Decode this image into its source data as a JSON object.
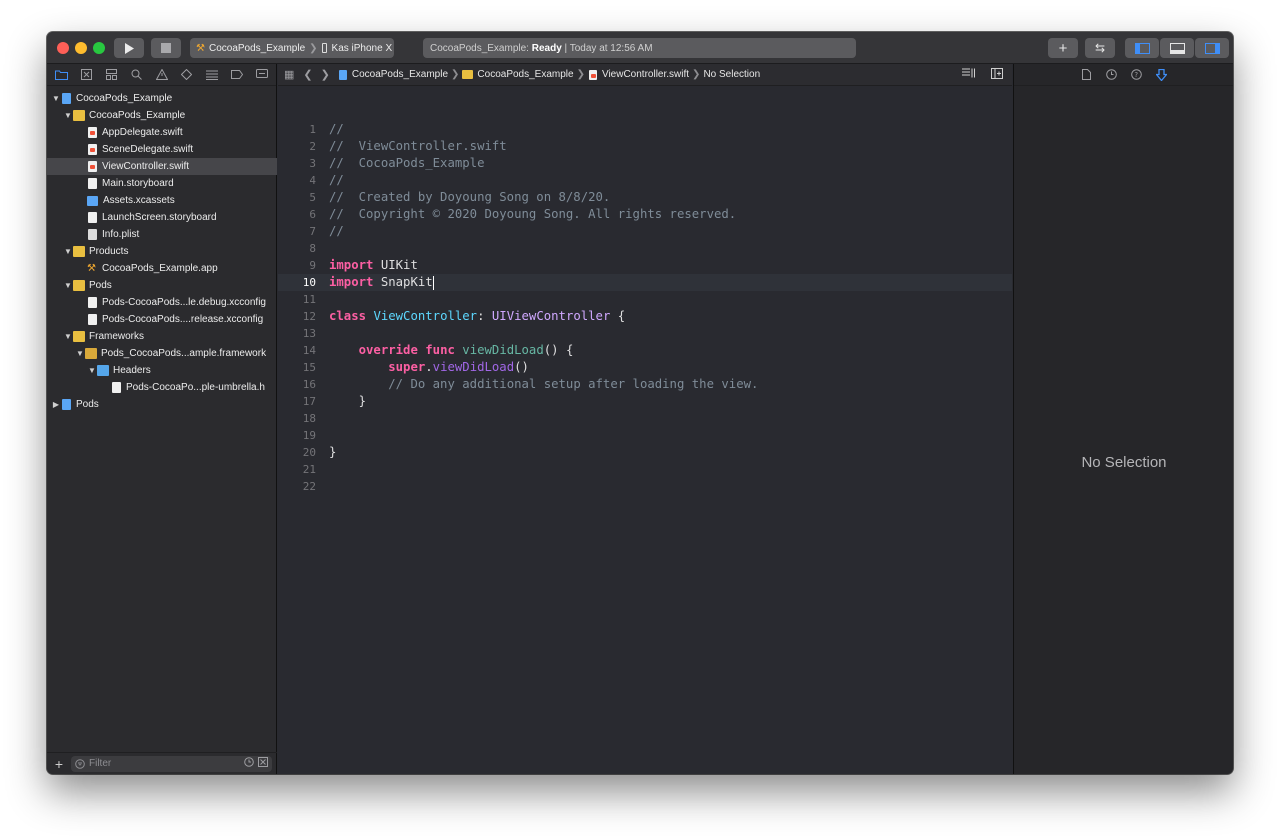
{
  "toolbar": {
    "scheme_name": "CocoaPods_Example",
    "device": "Kas iPhone X",
    "status_project": "CocoaPods_Example:",
    "status_state": "Ready",
    "status_time": "| Today at 12:56 AM",
    "run_icon": "play-icon",
    "stop_icon": "stop-icon",
    "add_icon": "plus-icon",
    "swap_icon": "code-review-icon"
  },
  "navigator": {
    "tabs": [
      "project-navigator",
      "source-control-navigator",
      "symbol-navigator",
      "find-navigator",
      "issue-navigator",
      "test-navigator",
      "debug-navigator",
      "breakpoint-navigator",
      "report-navigator"
    ],
    "items": [
      {
        "label": "CocoaPods_Example",
        "icon": "project-file-icon",
        "level": 0,
        "expanded": true
      },
      {
        "label": "CocoaPods_Example",
        "icon": "folder-icon",
        "level": 1,
        "expanded": true
      },
      {
        "label": "AppDelegate.swift",
        "icon": "swift-file-icon",
        "level": 2
      },
      {
        "label": "SceneDelegate.swift",
        "icon": "swift-file-icon",
        "level": 2
      },
      {
        "label": "ViewController.swift",
        "icon": "swift-file-icon",
        "level": 2,
        "selected": true
      },
      {
        "label": "Main.storyboard",
        "icon": "storyboard-icon",
        "level": 2
      },
      {
        "label": "Assets.xcassets",
        "icon": "assets-icon",
        "level": 2
      },
      {
        "label": "LaunchScreen.storyboard",
        "icon": "storyboard-icon",
        "level": 2
      },
      {
        "label": "Info.plist",
        "icon": "plist-icon",
        "level": 2
      },
      {
        "label": "Products",
        "icon": "folder-icon",
        "level": 1,
        "expanded": true
      },
      {
        "label": "CocoaPods_Example.app",
        "icon": "app-icon",
        "level": 2
      },
      {
        "label": "Pods",
        "icon": "folder-icon",
        "level": 1,
        "expanded": true
      },
      {
        "label": "Pods-CocoaPods...le.debug.xcconfig",
        "icon": "xcconfig-icon",
        "level": 2
      },
      {
        "label": "Pods-CocoaPods....release.xcconfig",
        "icon": "xcconfig-icon",
        "level": 2
      },
      {
        "label": "Frameworks",
        "icon": "folder-icon",
        "level": 1,
        "expanded": true
      },
      {
        "label": "Pods_CocoaPods...ample.framework",
        "icon": "framework-icon",
        "level": 2,
        "expanded": true
      },
      {
        "label": "Headers",
        "icon": "folder-icon",
        "level": 3,
        "expanded": true
      },
      {
        "label": "Pods-CocoaPo...ple-umbrella.h",
        "icon": "header-file-icon",
        "level": 4
      },
      {
        "label": "Pods",
        "icon": "project-file-icon",
        "level": 0,
        "expanded": false
      }
    ],
    "filter_placeholder": "Filter"
  },
  "editor": {
    "breadcrumbs": [
      "CocoaPods_Example",
      "CocoaPods_Example",
      "ViewController.swift",
      "No Selection"
    ],
    "current_line": 10,
    "lines": [
      "//",
      "//  ViewController.swift",
      "//  CocoaPods_Example",
      "//",
      "//  Created by Doyoung Song on 8/8/20.",
      "//  Copyright © 2020 Doyoung Song. All rights reserved.",
      "//",
      "",
      "import UIKit",
      "import SnapKit",
      "",
      "class ViewController: UIViewController {",
      "",
      "    override func viewDidLoad() {",
      "        super.viewDidLoad()",
      "        // Do any additional setup after loading the view.",
      "    }",
      "",
      "",
      "}",
      "",
      ""
    ]
  },
  "inspector": {
    "empty_label": "No Selection"
  },
  "colors": {
    "editor_bg": "#292a30",
    "keyword": "#fc5fa3",
    "type": "#5dd8ff",
    "comment": "#7f8c98",
    "accent": "#3f8ef7"
  }
}
